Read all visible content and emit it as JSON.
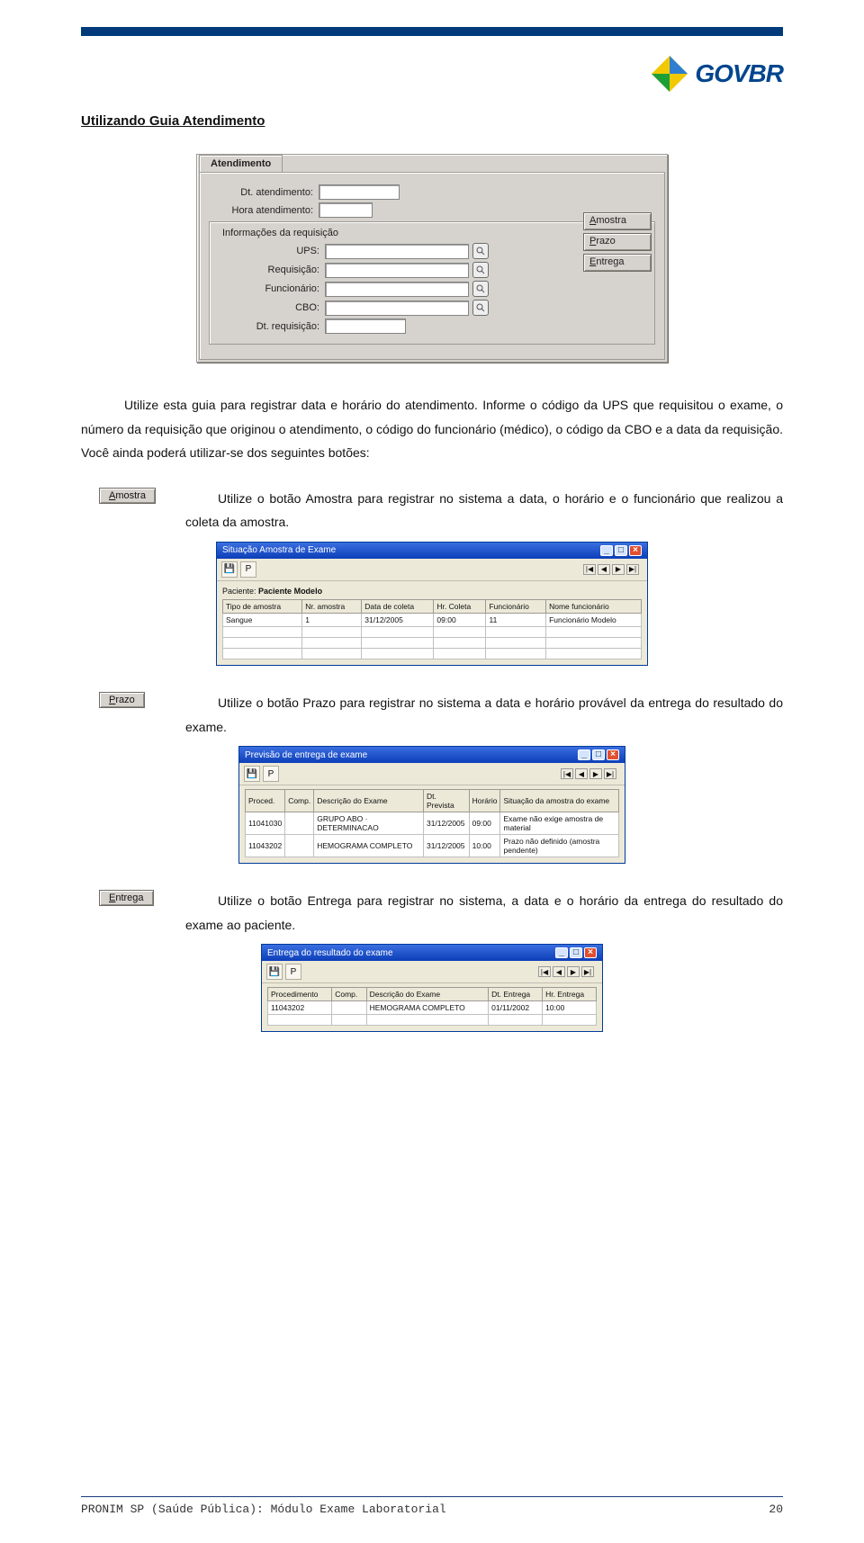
{
  "header": {
    "logo_text": "GOVBR"
  },
  "section_title": "Utilizando Guia Atendimento",
  "form": {
    "tab_label": "Atendimento",
    "labels": {
      "dt_atend": "Dt. atendimento:",
      "hora_atend": "Hora atendimento:",
      "fieldset": "Informações da requisição",
      "ups": "UPS:",
      "requisicao": "Requisição:",
      "funcionario": "Funcionário:",
      "cbo": "CBO:",
      "dt_req": "Dt. requisição:"
    },
    "side_buttons": {
      "amostra": "Amostra",
      "prazo": "Prazo",
      "entrega": "Entrega"
    }
  },
  "paragraphs": {
    "intro": "Utilize esta guia para registrar data e horário do atendimento. Informe o código da UPS que requisitou o exame, o número da requisição que originou o atendimento, o código do funcionário (médico), o código da CBO e a data da requisição. Você ainda poderá utilizar-se dos seguintes botões:",
    "amostra_text": "Utilize o botão Amostra para registrar no sistema a data, o horário e o funcionário que realizou a coleta da amostra.",
    "prazo_text": "Utilize o botão Prazo para registrar no sistema a data e horário provável da entrega do resultado do exame.",
    "entrega_text": "Utilize o botão Entrega para registrar no sistema, a data e o horário da entrega do resultado do exame ao paciente."
  },
  "buttons": {
    "amostra": "Amostra",
    "prazo": "Prazo",
    "entrega": "Entrega"
  },
  "amostra_win": {
    "title": "Situação Amostra de Exame",
    "paciente_label": "Paciente:",
    "paciente": "Paciente Modelo",
    "cols": [
      "Tipo de amostra",
      "Nr. amostra",
      "Data de coleta",
      "Hr. Coleta",
      "Funcionário",
      "Nome funcionário"
    ],
    "row": [
      "Sangue",
      "1",
      "31/12/2005",
      "09:00",
      "11",
      "Funcionário Modelo"
    ]
  },
  "prazo_win": {
    "title": "Previsão de entrega de exame",
    "cols": [
      "Proced.",
      "Comp.",
      "Descrição do Exame",
      "Dt. Prevista",
      "Horário",
      "Situação da amostra do exame"
    ],
    "rows": [
      [
        "11041030",
        "",
        "GRUPO ABO · DETERMINACAO",
        "31/12/2005",
        "09:00",
        "Exame não exige amostra de material"
      ],
      [
        "11043202",
        "",
        "HEMOGRAMA COMPLETO",
        "31/12/2005",
        "10:00",
        "Prazo não definido (amostra pendente)"
      ]
    ]
  },
  "entrega_win": {
    "title": "Entrega do resultado do exame",
    "cols": [
      "Procedimento",
      "Comp.",
      "Descrição do Exame",
      "Dt. Entrega",
      "Hr. Entrega"
    ],
    "row": [
      "11043202",
      "",
      "HEMOGRAMA COMPLETO",
      "01/11/2002",
      "10:00"
    ]
  },
  "footer": {
    "left": "PRONIM SP (Saúde Pública): Módulo Exame Laboratorial",
    "right": "20"
  }
}
